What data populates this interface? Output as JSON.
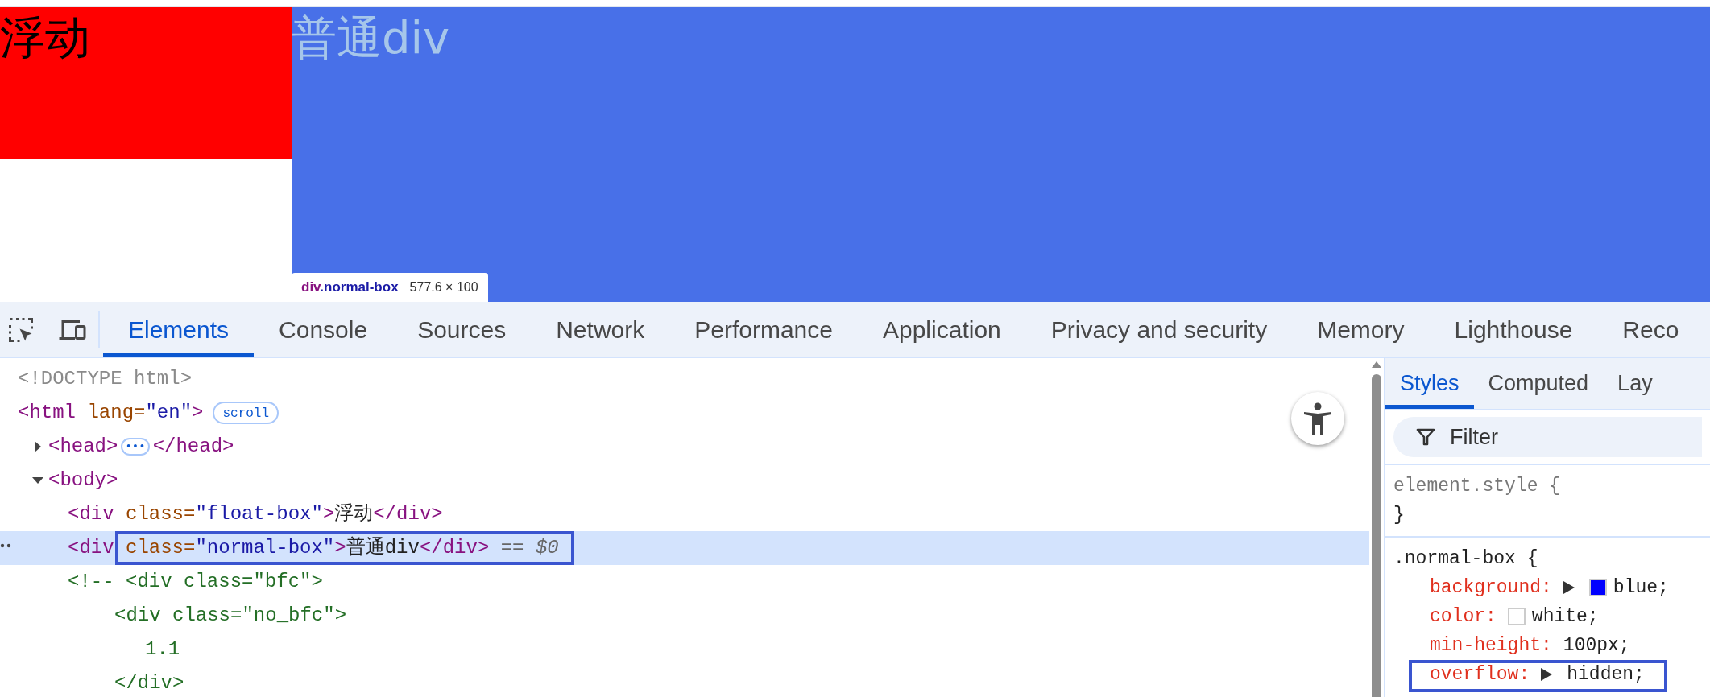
{
  "page": {
    "float_box": {
      "text": "浮动"
    },
    "normal_box": {
      "text": "普通div"
    },
    "tooltip": {
      "tag": "div",
      "classes": ".normal-box",
      "size": "577.6 × 100"
    }
  },
  "devtools": {
    "tabs": [
      {
        "label": "Elements",
        "selected": true
      },
      {
        "label": "Console",
        "selected": false
      },
      {
        "label": "Sources",
        "selected": false
      },
      {
        "label": "Network",
        "selected": false
      },
      {
        "label": "Performance",
        "selected": false
      },
      {
        "label": "Application",
        "selected": false
      },
      {
        "label": "Privacy and security",
        "selected": false
      },
      {
        "label": "Memory",
        "selected": false
      },
      {
        "label": "Lighthouse",
        "selected": false
      },
      {
        "label": "Reco",
        "selected": false
      }
    ],
    "dom_tree": [
      {
        "selected": false,
        "parts": [
          {
            "kind": "doctype",
            "text": "<!DOCTYPE html>"
          }
        ]
      },
      {
        "selected": false,
        "parts": [
          {
            "kind": "tag",
            "text": "<html"
          },
          {
            "kind": "attr",
            "text": " lang="
          },
          {
            "kind": "value",
            "text": "\"en\""
          },
          {
            "kind": "tag",
            "text": ">"
          },
          {
            "kind": "badge",
            "text": "scroll"
          }
        ],
        "children": [
          {
            "selected": false,
            "expanded": false,
            "parts": [
              {
                "kind": "tag",
                "text": "<head>"
              },
              {
                "kind": "ellipsis",
                "text": "•••"
              },
              {
                "kind": "tag",
                "text": "</head>"
              }
            ]
          },
          {
            "selected": false,
            "expanded": true,
            "parts": [
              {
                "kind": "tag",
                "text": "<body>"
              }
            ],
            "children": [
              {
                "selected": false,
                "parts": [
                  {
                    "kind": "tag",
                    "text": "<div"
                  },
                  {
                    "kind": "attr",
                    "text": " class="
                  },
                  {
                    "kind": "value",
                    "text": "\"float-box\""
                  },
                  {
                    "kind": "tag",
                    "text": ">"
                  },
                  {
                    "kind": "text",
                    "text": "浮动"
                  },
                  {
                    "kind": "tag",
                    "text": "</div>"
                  }
                ]
              },
              {
                "selected": true,
                "parts": [
                  {
                    "kind": "tag",
                    "text": "<div"
                  },
                  {
                    "kind": "attr",
                    "text": " class="
                  },
                  {
                    "kind": "value",
                    "text": "\"normal-box\""
                  },
                  {
                    "kind": "tag",
                    "text": ">"
                  },
                  {
                    "kind": "text",
                    "text": "普通div"
                  },
                  {
                    "kind": "tag",
                    "text": "</div>"
                  },
                  {
                    "kind": "ref",
                    "text": " == $0"
                  }
                ]
              },
              {
                "kind": "comment",
                "selected": false,
                "parts": [
                  {
                    "kind": "comment",
                    "text": "<!-- <div class=\"bfc\">"
                  }
                ],
                "children": [
                  {
                    "selected": false,
                    "parts": [
                      {
                        "kind": "comment",
                        "text": "<div class=\"no_bfc\">"
                      }
                    ],
                    "children": [
                      {
                        "selected": false,
                        "parts": [
                          {
                            "kind": "comment",
                            "text": "1.1"
                          }
                        ]
                      }
                    ]
                  },
                  {
                    "selected": false,
                    "parts": [
                      {
                        "kind": "comment",
                        "text": "</div>"
                      }
                    ]
                  }
                ]
              }
            ]
          }
        ]
      }
    ],
    "side_tabs": [
      {
        "label": "Styles",
        "selected": true
      },
      {
        "label": "Computed",
        "selected": false
      },
      {
        "label": "Lay",
        "selected": false
      }
    ],
    "filter": {
      "placeholder": "Filter"
    },
    "rules": [
      {
        "selector": "element.style {",
        "close": "}"
      },
      {
        "selector": ".normal-box {",
        "declarations": [
          {
            "property": "background:",
            "expandable": true,
            "color": "#0000ff",
            "value": "blue;"
          },
          {
            "property": "color:",
            "expandable": false,
            "color": "#ffffff",
            "value": "white;"
          },
          {
            "property": "min-height:",
            "expandable": false,
            "value": "100px;"
          },
          {
            "property": "overflow:",
            "expandable": true,
            "value": "hidden;"
          }
        ]
      }
    ]
  }
}
